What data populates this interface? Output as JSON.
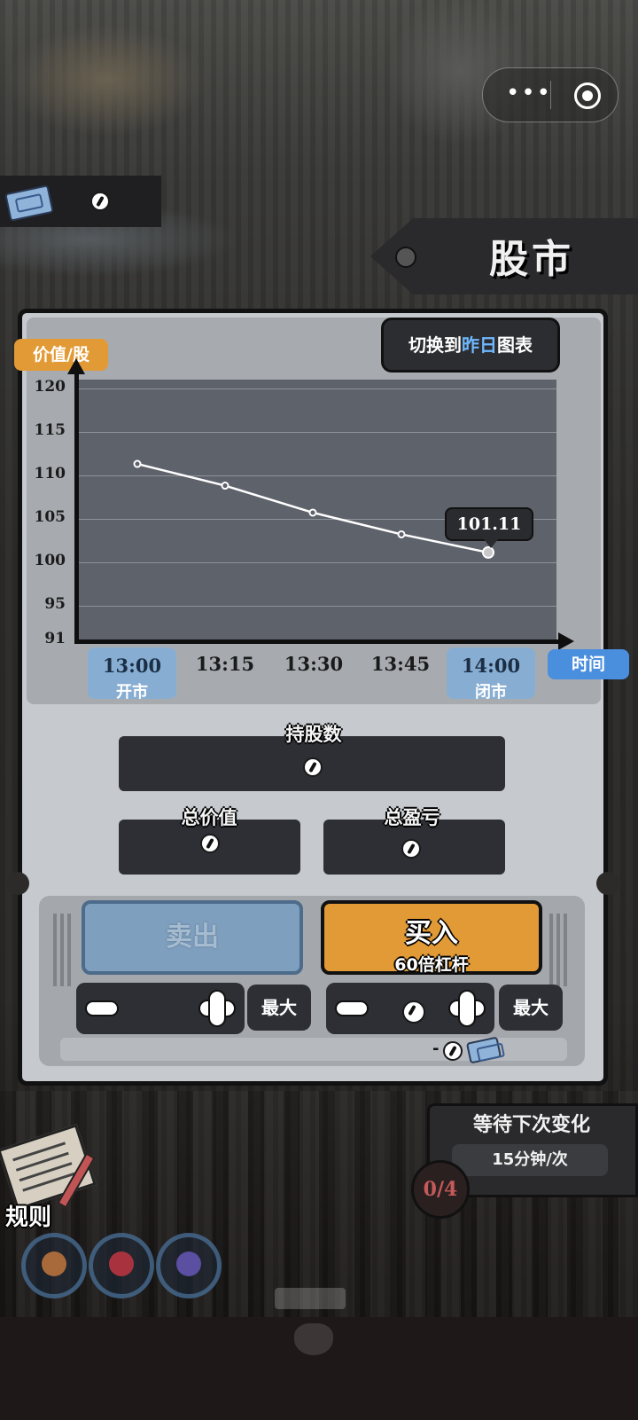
{
  "capsule": {
    "more": "•••"
  },
  "header": {
    "title": "股市"
  },
  "chart": {
    "switch_prefix": "切换到",
    "switch_highlight": "昨日",
    "switch_suffix": "图表",
    "ylabel": "价值/股",
    "xlabel": "时间",
    "current_value": "101.11",
    "open_time": "13:00",
    "open_label": "开市",
    "close_time": "14:00",
    "close_label": "闭市"
  },
  "chart_data": {
    "type": "line",
    "x": [
      "13:00",
      "13:15",
      "13:30",
      "13:45",
      "14:00"
    ],
    "series": [
      {
        "values": [
          111.3,
          108.8,
          105.7,
          103.2,
          101.11
        ]
      }
    ],
    "y_ticks": [
      "120",
      "115",
      "110",
      "105",
      "100",
      "95",
      "91"
    ],
    "ylim": [
      91,
      121
    ],
    "xlabel": "时间",
    "ylabel": "价值/股",
    "grid": true
  },
  "info": {
    "shares_label": "持股数",
    "total_value_label": "总价值",
    "total_pnl_label": "总盈亏"
  },
  "trade": {
    "sell_label": "卖出",
    "buy_label": "买入",
    "leverage_label": "60倍杠杆",
    "max_label": "最大",
    "cost_prefix": "-"
  },
  "rules": {
    "label": "规则"
  },
  "wait": {
    "title": "等待下次变化",
    "interval": "15分钟/次",
    "count": "0/4"
  },
  "colors": {
    "accent_orange": "#e29a36",
    "accent_blue": "#4a8ede",
    "panel": "#c6c9cd",
    "plot_bg": "#5e626b"
  }
}
